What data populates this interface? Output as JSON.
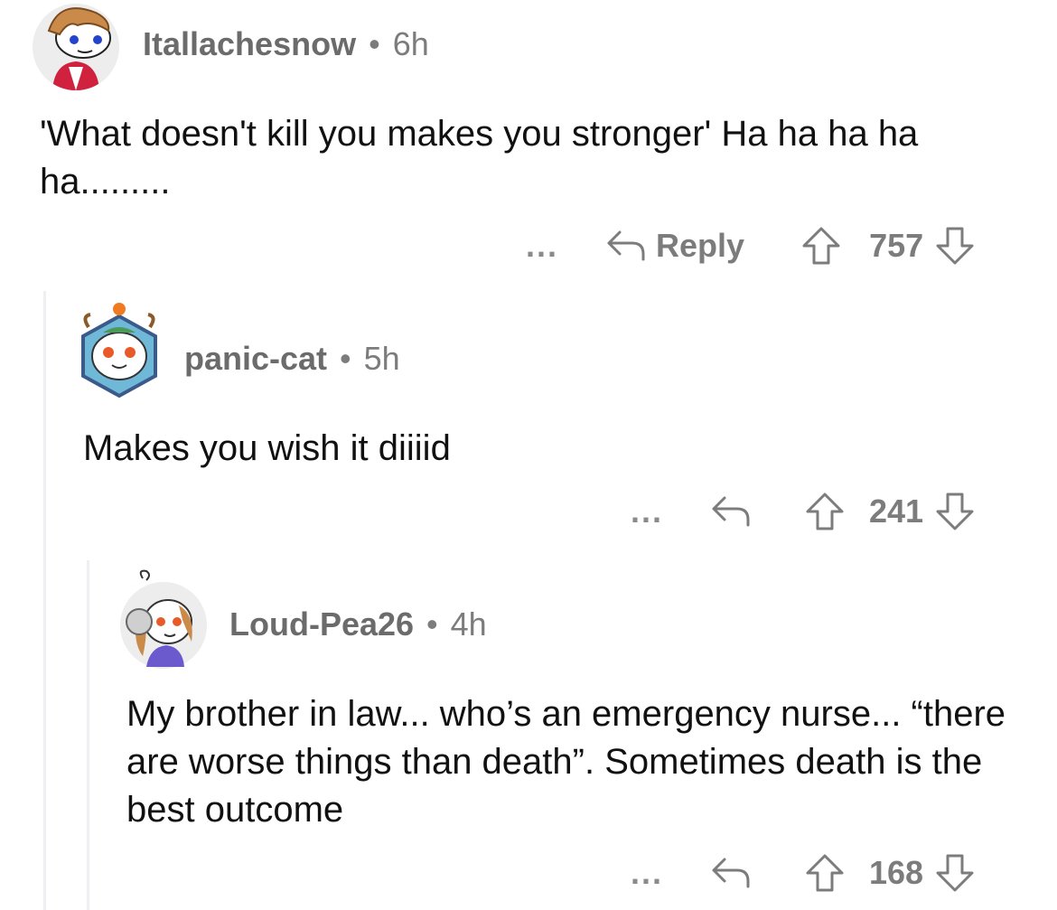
{
  "comments": [
    {
      "author": "Itallachesnow",
      "age": "6h",
      "body": "'What doesn't kill you makes you stronger' Ha ha ha ha ha.........",
      "more": "...",
      "reply_label": "Reply",
      "score": "757"
    },
    {
      "author": "panic-cat",
      "age": "5h",
      "body": "Makes you wish it diiiid",
      "more": "...",
      "score": "241"
    },
    {
      "author": "Loud-Pea26",
      "age": "4h",
      "body": "My brother in law... who’s an emergency nurse... “there are worse things than death”. Sometimes death is the best outcome",
      "more": "...",
      "score": "168"
    }
  ],
  "dot": "•"
}
